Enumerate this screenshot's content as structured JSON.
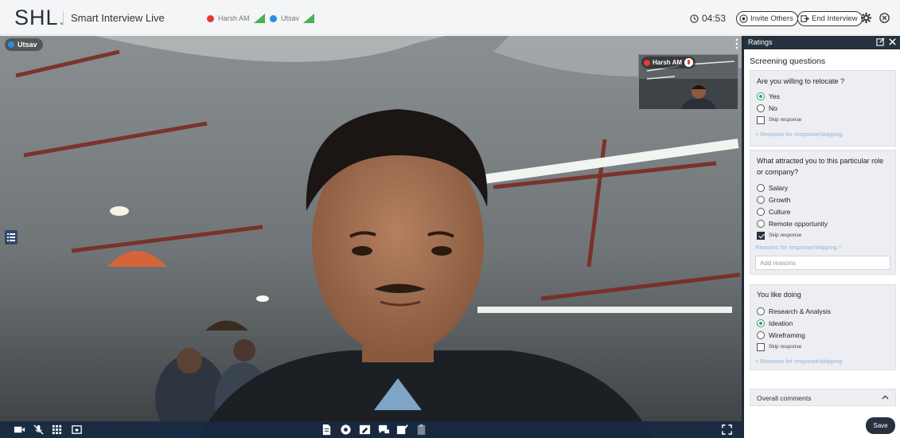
{
  "header": {
    "logo": "SHL",
    "logo_dot": ".",
    "app_title": "Smart Interview Live",
    "participants": [
      {
        "name": "Harsh AM",
        "dot_color": "#e53935"
      },
      {
        "name": "Utsav",
        "dot_color": "#2f8ae6"
      }
    ],
    "timer": "04:53",
    "invite_label": "Invite Others",
    "end_label": "End Interview"
  },
  "video": {
    "main_label": "Utsav",
    "pip_label": "Harsh AM"
  },
  "toolbar": {
    "left_icons": [
      "camera-icon",
      "mic-muted-icon",
      "grid-icon",
      "screen-share-icon"
    ],
    "center_icons": [
      "document-icon",
      "settings-circle-icon",
      "whiteboard-icon",
      "chat-icon",
      "notes-icon",
      "clipboard-icon"
    ],
    "right_icons": [
      "fullscreen-icon"
    ]
  },
  "ratings": {
    "panel_title": "Ratings",
    "section_title": "Screening questions",
    "questions": [
      {
        "text": "Are you willing to relocate ?",
        "options": [
          {
            "label": "Yes",
            "selected": true
          },
          {
            "label": "No",
            "selected": false
          }
        ],
        "skip_label": "Skip response",
        "skip_checked": false,
        "reasons_label": "+ Reasons for response/skipping"
      },
      {
        "text": "What attracted you to this particular role or company?",
        "options": [
          {
            "label": "Salary",
            "selected": false
          },
          {
            "label": "Growth",
            "selected": false
          },
          {
            "label": "Culture",
            "selected": false
          },
          {
            "label": "Remote opportunity",
            "selected": false
          }
        ],
        "skip_label": "Skip response",
        "skip_checked": true,
        "reasons_label": "Reasons for response/skipping ^",
        "reasons_placeholder": "Add reasons"
      },
      {
        "text": "You like doing",
        "options": [
          {
            "label": "Research & Analysis",
            "selected": false
          },
          {
            "label": "Ideation",
            "selected": true
          },
          {
            "label": "Wireframing",
            "selected": false
          }
        ],
        "skip_label": "Skip response",
        "skip_checked": false,
        "reasons_label": "+ Reasons for response/skipping"
      }
    ],
    "overall_comments": "Overall comments",
    "save_label": "Save"
  },
  "colors": {
    "accent_dark": "#27323f",
    "radio_selected": "#2e9e6a",
    "link": "#8fb4df"
  }
}
